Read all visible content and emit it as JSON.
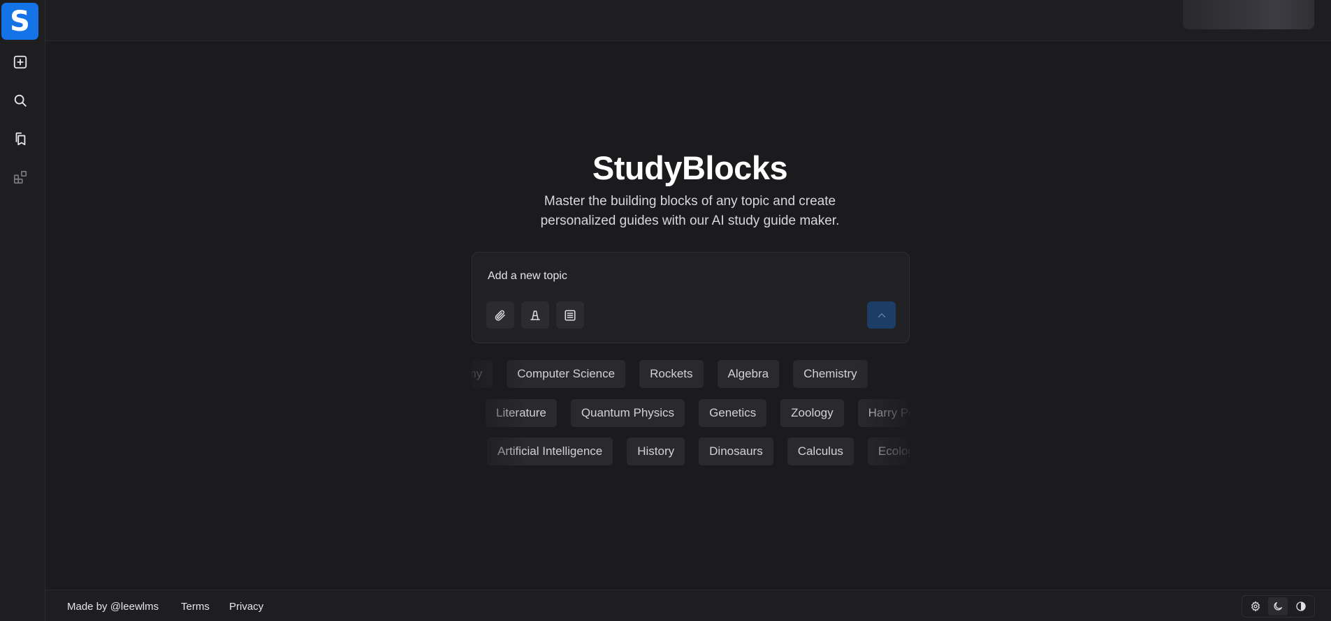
{
  "sidebar": {
    "logo_letter": "S",
    "items": [
      {
        "icon": "plus-square-icon",
        "label": "New"
      },
      {
        "icon": "search-icon",
        "label": "Search"
      },
      {
        "icon": "bookmarks-icon",
        "label": "Saved"
      },
      {
        "icon": "blocks-icon",
        "label": "Blocks"
      }
    ]
  },
  "hero": {
    "title": "StudyBlocks",
    "subtitle_line1": "Master the building blocks of any topic and create",
    "subtitle_line2": "personalized guides with our AI study guide maker."
  },
  "input": {
    "placeholder": "Add a new topic",
    "tools": [
      "paperclip-icon",
      "cone-icon",
      "document-lines-icon"
    ],
    "send_icon": "chevron-up-icon"
  },
  "topics": {
    "row1": [
      "Astronomy",
      "Computer Science",
      "Rockets",
      "Algebra",
      "Chemistry"
    ],
    "row2": [
      "Literature",
      "Quantum Physics",
      "Genetics",
      "Zoology",
      "Harry Potter"
    ],
    "row3": [
      "Artificial Intelligence",
      "History",
      "Dinosaurs",
      "Calculus",
      "Ecology"
    ]
  },
  "footer": {
    "made_by": "Made by @leewlms",
    "terms": "Terms",
    "privacy": "Privacy",
    "theme_options": [
      "gear-icon",
      "moon-icon",
      "contrast-icon"
    ],
    "active_theme": "moon-icon"
  },
  "colors": {
    "background": "#1b1b1e",
    "brand": "#1473e6",
    "chip": "#2a2a2e",
    "send_button": "#1b3d66"
  }
}
